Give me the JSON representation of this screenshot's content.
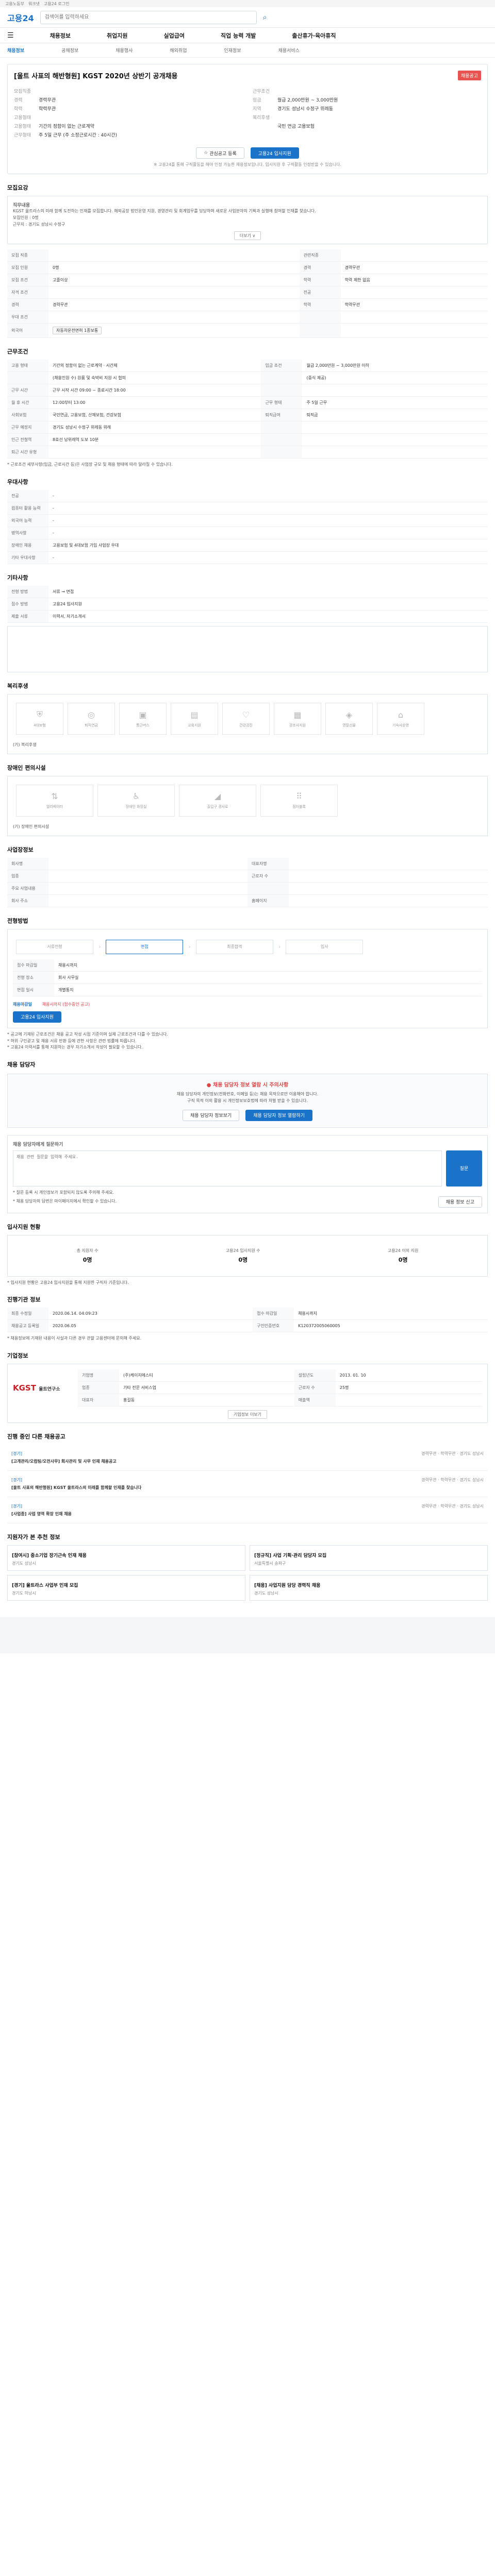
{
  "topbar": {
    "links": [
      "고용노동부",
      "워크넷",
      "고용24 로그인"
    ]
  },
  "header": {
    "logo": "고용24",
    "search_placeholder": "검색어를 입력하세요"
  },
  "gnb": {
    "items": [
      "채용정보",
      "취업지원",
      "실업급여",
      "직업 능력 개발",
      "출산휴가·육아휴직"
    ]
  },
  "subnav": {
    "items": [
      "채용정보",
      "공채정보",
      "채용행사",
      "해외취업",
      "인재정보",
      "채용서비스"
    ],
    "active": 0
  },
  "job": {
    "title": "[울트 사표의 해반형원] KGST 2020년 상반기 공개채용",
    "badge": "채용공고",
    "summary": [
      {
        "k": "모집직종",
        "v": ""
      },
      {
        "k": "근무조건",
        "v": ""
      },
      {
        "k": "경력",
        "v": "경력무관"
      },
      {
        "k": "임금",
        "v": "월급 2,000만원 ~ 3,000만원"
      },
      {
        "k": "학력",
        "v": "학력무관"
      },
      {
        "k": "지역",
        "v": "경기도 성남시 수정구 위례동"
      },
      {
        "k": "고용형태",
        "v": ""
      },
      {
        "k": "복리후생",
        "v": ""
      },
      {
        "k": "고용형태",
        "v": "기간의 정함이 없는 근로계약"
      },
      {
        "k": "",
        "v": "국민 연금 고용보험"
      },
      {
        "k": "근무형태",
        "v": "주 5일 근무 (주 소정근로시간 : 40시간)"
      }
    ],
    "actions": {
      "interest": "관심공고 등록",
      "apply": "고용24 입사지원"
    },
    "note": "※ 고용24를 통해 구직활동을 해야 인정 가능한 채용정보입니다. 입사지원 후 구직활동 인정받을 수 있습니다."
  },
  "recruit": {
    "title": "모집요강",
    "body_title": "직무내용",
    "body": "KGST 울트라스의 미래 함께 도전하는 인재를 모집합니다. 해외공장 법인운영 지원, 경영관리 및 회계업무를 담당하며 새로운 사업분야의 기획과 실행에 참여할 인재를 찾습니다.",
    "bullets": [
      "모집인원 : 0명",
      "근무지 : 경기도 성남시 수정구"
    ],
    "more": "더보기 ∨"
  },
  "conditions": {
    "rows": [
      {
        "k": "모집 직종",
        "v": "",
        "k2": "관련직종",
        "v2": ""
      },
      {
        "k": "모집 인원",
        "v": "0명",
        "k2": "경력",
        "v2": "경력무관"
      },
      {
        "k": "모집 조건",
        "v": "고졸이상",
        "k2": "학력",
        "v2": "학력 제한 없음"
      },
      {
        "k": "자격 조건",
        "v": "",
        "k2": "전공",
        "v2": ""
      },
      {
        "k": "경력",
        "v": "경력무관",
        "k2": "학력",
        "v2": "학력무관"
      },
      {
        "k": "우대 조건",
        "v": "",
        "k2": "",
        "v2": ""
      },
      {
        "k": "외국어",
        "v": "자동차운전면허 1종보통",
        "k2": "",
        "v2": ""
      }
    ]
  },
  "work": {
    "title": "근무조건",
    "rows": [
      {
        "k": "고용 형태",
        "v": "기간의 정함이 없는 근로계약 · 시간제",
        "k2": "임금 조건",
        "v2": "월급 2,000만원 ~ 3,000만원 이하"
      },
      {
        "k": "",
        "v": "(채용인원 수) 원룸 및 숙박비 지원 시 협의",
        "k2": "",
        "v2": "(중식 제공)"
      },
      {
        "k": "근무 시간",
        "v": "근무 시작 시간 09:00 ~ 종료시간 18:00",
        "k2": "",
        "v2": ""
      },
      {
        "k": "월 휴 시간",
        "v": "12:00부터 13:00",
        "k2": "근무 형태",
        "v2": "주 5일 근무"
      },
      {
        "k": "사회보험",
        "v": "국민연금, 고용보험, 산재보험, 건강보험",
        "k2": "퇴직급여",
        "v2": "퇴직금"
      },
      {
        "k": "근무 예정지",
        "v": "경기도 성남시 수정구 위례동 위례",
        "k2": "",
        "v2": ""
      },
      {
        "k": "인근 전철역",
        "v": "8호선 남위례역 도보 10분",
        "k2": "",
        "v2": ""
      },
      {
        "k": "퇴근 시간 유형",
        "v": "",
        "k2": "",
        "v2": ""
      }
    ],
    "note": "* 근로조건 세부사항(임금, 근로시간 등)은 사업장 규모 및 채용 형태에 따라 달라질 수 있습니다."
  },
  "etc": {
    "title": "우대사항",
    "rows": [
      {
        "k": "전공",
        "v": "-"
      },
      {
        "k": "컴퓨터 활용 능력",
        "v": "-"
      },
      {
        "k": "외국어 능력",
        "v": "-"
      },
      {
        "k": "병역사항",
        "v": "-"
      },
      {
        "k": "장애인 채용",
        "v": "고용보험 및 4대보험 가입 사업장 우대"
      },
      {
        "k": "기타 우대사항",
        "v": "-"
      }
    ]
  },
  "other": {
    "title": "기타사항",
    "rows": [
      {
        "k": "전형 방법",
        "v": "서류 → 면접"
      },
      {
        "k": "접수 방법",
        "v": "고용24 입사지원"
      },
      {
        "k": "제출 서류",
        "v": "이력서, 자기소개서"
      }
    ]
  },
  "welfare": {
    "title": "복리후생",
    "tiles": [
      "4대보험",
      "퇴직연금",
      "통근버스",
      "교육지원",
      "건강검진",
      "경조사지원",
      "명절선물",
      "기숙사운영"
    ],
    "extra": "(기) 복리후생"
  },
  "disability": {
    "title": "장애인 편의시설",
    "tiles": [
      "엘리베이터",
      "장애인 화장실",
      "출입구 경사로",
      "점자블록"
    ],
    "extra": "(기) 장애인 편의시설"
  },
  "place": {
    "title": "사업장정보",
    "rows": [
      {
        "k": "회사명",
        "v": "",
        "k2": "대표자명",
        "v2": ""
      },
      {
        "k": "업종",
        "v": "",
        "k2": "근로자 수",
        "v2": ""
      },
      {
        "k": "주요 사업내용",
        "v": "",
        "k2": "",
        "v2": ""
      },
      {
        "k": "회사 주소",
        "v": "",
        "k2": "홈페이지",
        "v2": ""
      }
    ]
  },
  "process": {
    "title": "전형방법",
    "steps": [
      "서류전형",
      "면접",
      "최종합격",
      "입사"
    ],
    "dates": [
      {
        "k": "접수 마감일",
        "v": "채용시까지"
      },
      {
        "k": "전형 장소",
        "v": "회사 사무실"
      },
      {
        "k": "면접 일시",
        "v": "개별통지"
      }
    ],
    "apply_label": "채용마감일",
    "apply_value": "채용시까지 (접수중인 공고)",
    "apply_button": "고용24 입사지원",
    "notes": [
      "* 공고에 기재된 근로조건은 채용 공고 작성 시점 기준이며 실제 근로조건과 다를 수 있습니다.",
      "* 허위 구인광고 및 채용 서류 반환 등에 관한 사항은 관련 법률에 따릅니다.",
      "* 고용24 이력서를 통해 지원하는 경우 자기소개서 작성이 필요할 수 있습니다."
    ]
  },
  "manager": {
    "title": "채용 담당자",
    "warn": "● 채용 담당자 정보 열람 시 주의사항",
    "lines": [
      "채용 담당자의 개인정보(전화번호, 이메일 등)는 채용 목적으로만 이용해야 합니다.",
      "구직 목적 이외 활용 시 개인정보보호법에 따라 처벌 받을 수 있습니다."
    ],
    "btn1": "채용 담당자 정보보기",
    "btn2": "채용 담당자 정보 열람하기"
  },
  "inquiry": {
    "title": "채용 담당자에게 질문하기",
    "placeholder": "채용 관련 질문을 입력해 주세요.",
    "send": "질문",
    "notes": [
      "* 질문 등록 시 개인정보가 포함되지 않도록 주의해 주세요.",
      "* 채용 담당자의 답변은 마이페이지에서 확인할 수 있습니다."
    ],
    "report": "채용 정보 신고"
  },
  "status": {
    "title": "입사지원 현황",
    "items": [
      {
        "k": "총 지원자 수",
        "v": "0명"
      },
      {
        "k": "고용24 입사지원 수",
        "v": "0명"
      },
      {
        "k": "고용24 이외 지원",
        "v": "0명"
      }
    ],
    "note": "* 입사지원 현황은 고용24 입사지원을 통해 지원한 구직자 기준입니다."
  },
  "info": {
    "title": "진행기관 정보",
    "rows": [
      {
        "k": "최종 수정일",
        "v": "2020.06.14. 04:09:23",
        "k2": "접수 마감일",
        "v2": "채용시까지"
      },
      {
        "k": "채용공고 등록일",
        "v": "2020.06.05",
        "k2": "구인인증번호",
        "v2": "K120372005060005"
      }
    ],
    "note": "* 채용정보에 기재된 내용이 사실과 다른 경우 관할 고용센터에 문의해 주세요."
  },
  "company": {
    "title": "기업정보",
    "logo": "KGST",
    "logo_sub": "울트연구소",
    "fields": [
      {
        "k": "기업명",
        "v": "(주)케이지에스티"
      },
      {
        "k": "설립년도",
        "v": "2013. 01. 10"
      },
      {
        "k": "업종",
        "v": "기타 전문 서비스업"
      },
      {
        "k": "근로자 수",
        "v": "25명"
      },
      {
        "k": "대표자",
        "v": "홍길동"
      },
      {
        "k": "매출액",
        "v": ""
      }
    ],
    "more": "기업정보 더보기"
  },
  "same": {
    "title": "진행 중인 다른 채용공고",
    "items": [
      {
        "tag": "[경기]",
        "t": "[고개관리/오컴팅/오전사무] 회사관리 및 사무 인재 채용공고",
        "meta": "경력무관 · 학력무관 · 경기도 성남시"
      },
      {
        "tag": "[경기]",
        "t": "[울트 사표의 해반형원] KGST 울트라스의 미래를 함께할 인재를 찾습니다",
        "meta": "경력무관 · 학력무관 · 경기도 성남시"
      },
      {
        "tag": "[경기]",
        "t": "[사업종] 사업 영역 확장 인재 채용",
        "meta": "경력무관 · 학력무관 · 경기도 성남시"
      }
    ]
  },
  "similar": {
    "title": "지원자가 본 추천 정보",
    "items": [
      {
        "t": "[참여시] 중소기업 장기근속 인재 채용",
        "meta": "경기도 성남시"
      },
      {
        "t": "[정규직] 사업 기획·관리 담당자 모집",
        "meta": "서울특별시 송파구"
      },
      {
        "t": "[경기] 울트라스 사업부 인재 모집",
        "meta": "경기도 하남시"
      },
      {
        "t": "[채용] 사업지원 담당 경력직 채용",
        "meta": "경기도 성남시"
      }
    ]
  }
}
